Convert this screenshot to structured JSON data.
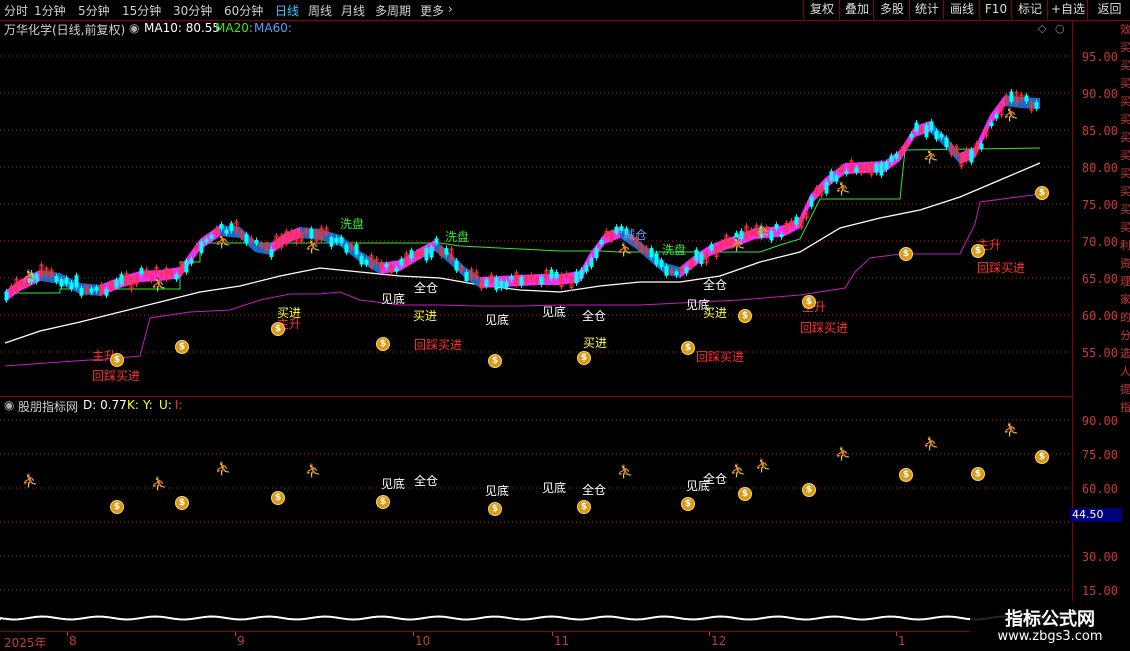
{
  "toolbar": {
    "periods": [
      "分时",
      "1分钟",
      "5分钟",
      "15分钟",
      "30分钟",
      "60分钟",
      "日线",
      "周线",
      "月线",
      "多周期",
      "更多"
    ],
    "active_period": "日线",
    "buttons": [
      "复权",
      "叠加",
      "多股",
      "统计",
      "画线",
      "F10",
      "标记",
      "+自选",
      "返回"
    ]
  },
  "main_info": {
    "title": "万华化学(日线,前复权)",
    "ma10": "MA10: 80.55",
    "ma20": "MA20:",
    "ma60": "MA60:"
  },
  "sub_info": {
    "title": "股朋指标网",
    "d": "D: 0.77",
    "k": "K:",
    "y": "Y:",
    "u": "U:",
    "i": "I:"
  },
  "main_yaxis": [
    "95.00",
    "90.00",
    "85.00",
    "80.00",
    "75.00",
    "70.00",
    "65.00",
    "60.00",
    "55.00"
  ],
  "sub_yaxis": [
    "90.00",
    "75.00",
    "60.00",
    "45.00",
    "30.00",
    "15.00"
  ],
  "cursor_value": "44.50",
  "date_axis": [
    "2025年",
    "8",
    "9",
    "10",
    "11",
    "12",
    "1"
  ],
  "right_strip": "效买买买买买买买买买买买利资理家的分选人提指",
  "main_labels": {
    "xipan1": "洗盘",
    "xipan2": "洗盘",
    "xipan3": "洗盘",
    "jiancang": "减仓",
    "jiandi1": "见底",
    "jiandi2": "见底",
    "jiandi3": "见底",
    "jiandi4": "见底",
    "quancang1": "全仓",
    "quancang2": "全仓",
    "quancang3": "全仓",
    "maijin1": "买进",
    "maijin2": "买进",
    "maijin3": "买进",
    "maijin4": "买进",
    "zhusheng1": "主升",
    "zhusheng2": "主升",
    "zhusheng3": "主升",
    "zhusheng4": "主升",
    "huicai1": "回踩买进",
    "huicai2": "回踩买进",
    "huicai3": "回踩买进",
    "huicai4": "回踩买进",
    "huicai5": "回踩买进"
  },
  "sub_labels": {
    "jiandi1": "见底",
    "jiandi2": "见底",
    "jiandi3": "见底",
    "jiandi4": "见底",
    "quancang1": "全仓",
    "quancang2": "全仓",
    "quancang3": "全仓"
  },
  "watermark": {
    "title": "指标公式网",
    "url": "www.zbgs3.com"
  },
  "colors": {
    "up": "#ff3030",
    "down": "#00ffff",
    "ribbon_up": "#ff30ff",
    "ribbon_down": "#1e6fd0",
    "ma_white": "#ffffff",
    "line_green": "#32e632",
    "line_magenta": "#c020c0",
    "grid": "#c01818"
  }
}
